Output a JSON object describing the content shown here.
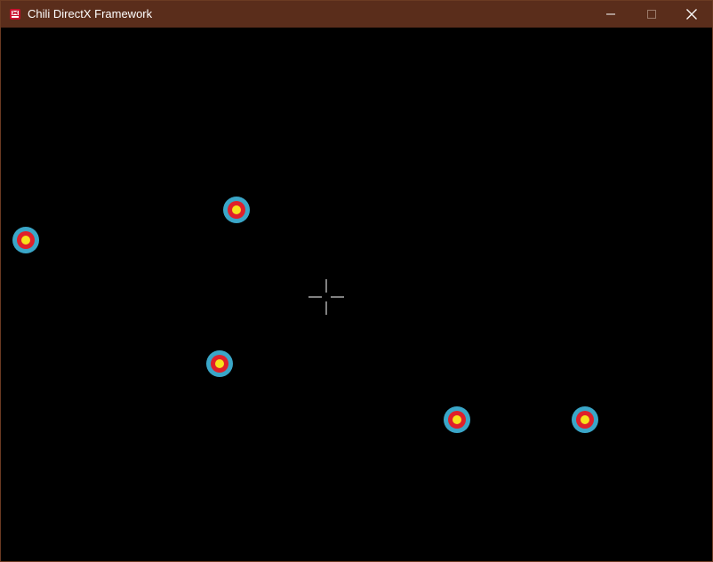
{
  "window": {
    "title": "Chili DirectX Framework"
  },
  "icons": {
    "app": "chili-app-icon",
    "minimize": "minimize-icon",
    "maximize": "maximize-icon",
    "close": "close-icon",
    "crosshair": "crosshair-icon",
    "target": "target-icon"
  },
  "colors": {
    "titlebar": "#5a2d1b",
    "canvas": "#000000",
    "target_outer": "#3aa6c8",
    "target_middle": "#e0202a",
    "target_center": "#f7e21c",
    "crosshair": "#ffffff"
  },
  "game": {
    "target_count": 5
  }
}
